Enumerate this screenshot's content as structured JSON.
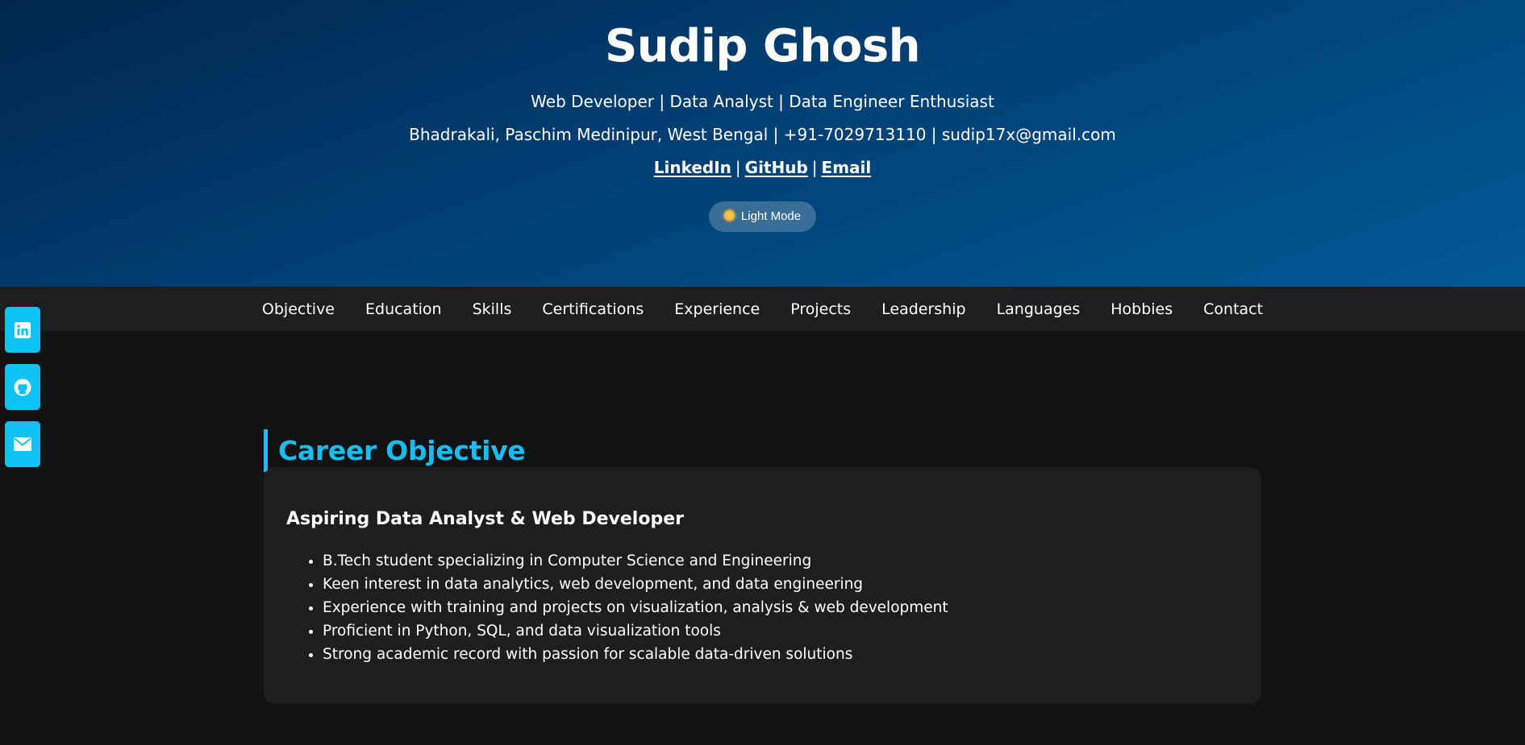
{
  "header": {
    "name": "Sudip Ghosh",
    "subtitle": "Web Developer | Data Analyst | Data Engineer Enthusiast",
    "contact": "Bhadrakali, Paschim Medinipur, West Bengal | +91-7029713110 | sudip17x@gmail.com",
    "links": {
      "linkedin": "LinkedIn",
      "github": "GitHub",
      "email": "Email",
      "separator": "|"
    },
    "theme_toggle": {
      "icon": "sun-icon",
      "label": "Light Mode"
    }
  },
  "nav": {
    "items": [
      "Objective",
      "Education",
      "Skills",
      "Certifications",
      "Experience",
      "Projects",
      "Leadership",
      "Languages",
      "Hobbies",
      "Contact"
    ]
  },
  "social_sidebar": {
    "icons": [
      "linkedin-icon",
      "github-icon",
      "email-icon"
    ],
    "color": "#0ec2f4"
  },
  "objective": {
    "heading": "Career Objective",
    "card_title": "Aspiring Data Analyst & Web Developer",
    "points": [
      "B.Tech student specializing in Computer Science and Engineering",
      "Keen interest in data analytics, web development, and data engineering",
      "Experience with training and projects on visualization, analysis & web development",
      "Proficient in Python, SQL, and data visualization tools",
      "Strong academic record with passion for scalable data-driven solutions"
    ]
  },
  "colors": {
    "accent": "#0ec2f4",
    "background": "#121212",
    "card": "#1e1e1e",
    "header_gradient_start": "#00264d",
    "header_gradient_end": "#005996"
  }
}
